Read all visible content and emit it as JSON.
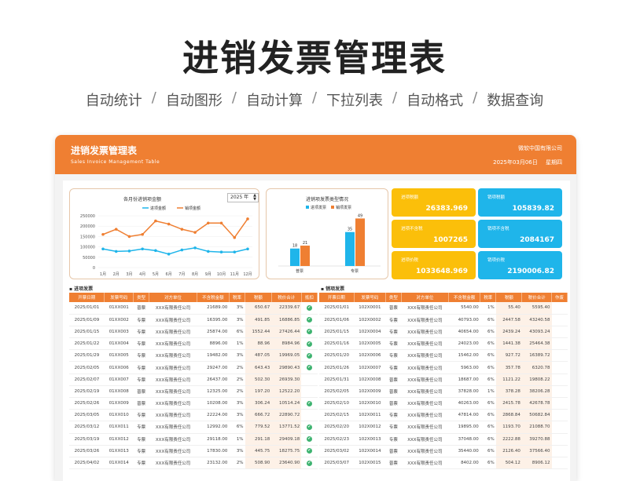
{
  "hero": {
    "title": "进销发票管理表",
    "features": [
      "自动统计",
      "自动图形",
      "自动计算",
      "下拉列表",
      "自动格式",
      "数据查询"
    ]
  },
  "header": {
    "title": "进销发票管理表",
    "subtitle": "Sales Invoice Management Table",
    "company": "微软中国有限公司",
    "date": "2025年03月06日",
    "weekday": "星期四"
  },
  "line_panel": {
    "title": "各月份进销项金额",
    "year": "2025 年"
  },
  "bar_panel": {
    "title": "进销项发票类型情况"
  },
  "kpis": [
    {
      "label": "进项税额",
      "value": "26383.969",
      "color": "#fbbf0a"
    },
    {
      "label": "销项税额",
      "value": "105839.82",
      "color": "#1fb5ea"
    },
    {
      "label": "进项不含税",
      "value": "1007265",
      "color": "#fbbf0a"
    },
    {
      "label": "销项不含税",
      "value": "2084167",
      "color": "#1fb5ea"
    },
    {
      "label": "进项价税",
      "value": "1033648.969",
      "color": "#fbbf0a"
    },
    {
      "label": "销项价税",
      "value": "2190006.82",
      "color": "#1fb5ea"
    }
  ],
  "chart_data": [
    {
      "type": "line",
      "title": "各月份进销项金额",
      "x": [
        "1月",
        "2月",
        "3月",
        "4月",
        "5月",
        "6月",
        "7月",
        "8月",
        "9月",
        "10月",
        "11月",
        "12月"
      ],
      "yticks": [
        "250000",
        "200000",
        "150000",
        "100000",
        "50000",
        "0"
      ],
      "ylim": [
        0,
        250000
      ],
      "series": [
        {
          "name": "进项金额",
          "color": "#1fb5ea",
          "values": [
            90000,
            78000,
            80000,
            90000,
            82000,
            65000,
            85000,
            95000,
            78000,
            75000,
            75000,
            90000
          ]
        },
        {
          "name": "销项金额",
          "color": "#ef7f32",
          "values": [
            160000,
            185000,
            150000,
            160000,
            225000,
            210000,
            185000,
            170000,
            215000,
            215000,
            145000,
            235000
          ]
        }
      ],
      "legend": "top"
    },
    {
      "type": "bar",
      "title": "进销项发票类型情况",
      "categories": [
        "普票",
        "专票"
      ],
      "series": [
        {
          "name": "进项发票",
          "color": "#1fb5ea",
          "values": [
            18,
            35
          ]
        },
        {
          "name": "销项发票",
          "color": "#ef7f32",
          "values": [
            21,
            49
          ]
        }
      ],
      "ylim": [
        0,
        55
      ],
      "legend": "top"
    }
  ],
  "purchase": {
    "label": "进项发票",
    "headers": [
      "开票日期",
      "发票号码",
      "类型",
      "对方单位",
      "不含税金额",
      "税率",
      "税额",
      "税价合计",
      "抵扣"
    ],
    "rows": [
      [
        "2025/01/01",
        "01XX001",
        "普票",
        "XXX有限责任公司",
        "21689.00",
        "3%",
        "650.67",
        "22339.67",
        "✔"
      ],
      [
        "2025/01/09",
        "01XX002",
        "专票",
        "XXX有限责任公司",
        "16395.00",
        "3%",
        "491.85",
        "16886.85",
        "✔"
      ],
      [
        "2025/01/15",
        "01XX003",
        "专票",
        "XXX有限责任公司",
        "25874.00",
        "6%",
        "1552.44",
        "27426.44",
        "✔"
      ],
      [
        "2025/01/22",
        "01XX004",
        "专票",
        "XXX有限责任公司",
        "8896.00",
        "1%",
        "88.96",
        "8984.96",
        "✔"
      ],
      [
        "2025/01/29",
        "01XX005",
        "专票",
        "XXX有限责任公司",
        "19482.00",
        "3%",
        "487.05",
        "19969.05",
        "✔"
      ],
      [
        "2025/02/05",
        "01XX006",
        "专票",
        "XXX有限责任公司",
        "29247.00",
        "2%",
        "643.43",
        "29890.43",
        "✔"
      ],
      [
        "2025/02/07",
        "01XX007",
        "专票",
        "XXX有限责任公司",
        "26437.00",
        "2%",
        "502.30",
        "26939.30",
        ""
      ],
      [
        "2025/02/19",
        "01XX008",
        "普票",
        "XXX有限责任公司",
        "12325.00",
        "2%",
        "197.20",
        "12522.20",
        ""
      ],
      [
        "2025/02/26",
        "01XX009",
        "普票",
        "XXX有限责任公司",
        "10208.00",
        "3%",
        "306.24",
        "10514.24",
        "✔"
      ],
      [
        "2025/03/05",
        "01XX010",
        "专票",
        "XXX有限责任公司",
        "22224.00",
        "3%",
        "666.72",
        "22890.72",
        ""
      ],
      [
        "2025/03/12",
        "01XX011",
        "专票",
        "XXX有限责任公司",
        "12992.00",
        "6%",
        "779.52",
        "13771.52",
        "✔"
      ],
      [
        "2025/03/19",
        "01XX012",
        "专票",
        "XXX有限责任公司",
        "29118.00",
        "1%",
        "291.18",
        "29409.18",
        "✔"
      ],
      [
        "2025/03/26",
        "01XX013",
        "专票",
        "XXX有限责任公司",
        "17830.00",
        "3%",
        "445.75",
        "18275.75",
        "✔"
      ],
      [
        "2025/04/02",
        "01XX014",
        "专票",
        "XXX有限责任公司",
        "23132.00",
        "2%",
        "508.90",
        "23640.90",
        "✔"
      ]
    ]
  },
  "sales": {
    "label": "销项发票",
    "headers": [
      "开票日期",
      "发票号码",
      "类型",
      "对方单位",
      "不含税金额",
      "税率",
      "税额",
      "税价合计",
      "作废"
    ],
    "rows": [
      [
        "2025/01/01",
        "102X0001",
        "普票",
        "XXX有限责任公司",
        "5540.00",
        "1%",
        "55.40",
        "5595.40",
        ""
      ],
      [
        "2025/01/06",
        "102X0002",
        "专票",
        "XXX有限责任公司",
        "40793.00",
        "6%",
        "2447.58",
        "43240.58",
        ""
      ],
      [
        "2025/01/15",
        "102X0004",
        "专票",
        "XXX有限责任公司",
        "40654.00",
        "6%",
        "2439.24",
        "43093.24",
        ""
      ],
      [
        "2025/01/16",
        "102X0005",
        "专票",
        "XXX有限责任公司",
        "24023.00",
        "6%",
        "1441.38",
        "25464.38",
        ""
      ],
      [
        "2025/01/20",
        "102X0006",
        "专票",
        "XXX有限责任公司",
        "15462.00",
        "6%",
        "927.72",
        "16389.72",
        ""
      ],
      [
        "2025/01/26",
        "102X0007",
        "专票",
        "XXX有限责任公司",
        "5963.00",
        "6%",
        "357.78",
        "6320.78",
        ""
      ],
      [
        "2025/01/31",
        "102X0008",
        "普票",
        "XXX有限责任公司",
        "18687.00",
        "6%",
        "1121.22",
        "19808.22",
        ""
      ],
      [
        "2025/02/05",
        "102X0009",
        "普票",
        "XXX有限责任公司",
        "37828.00",
        "1%",
        "378.28",
        "38206.28",
        ""
      ],
      [
        "2025/02/10",
        "102X0010",
        "普票",
        "XXX有限责任公司",
        "40263.00",
        "6%",
        "2415.78",
        "42678.78",
        ""
      ],
      [
        "2025/02/15",
        "102X0011",
        "专票",
        "XXX有限责任公司",
        "47814.00",
        "6%",
        "2868.84",
        "50682.84",
        ""
      ],
      [
        "2025/02/20",
        "102X0012",
        "专票",
        "XXX有限责任公司",
        "19895.00",
        "6%",
        "1193.70",
        "21088.70",
        ""
      ],
      [
        "2025/02/23",
        "102X0013",
        "专票",
        "XXX有限责任公司",
        "37048.00",
        "6%",
        "2222.88",
        "39270.88",
        ""
      ],
      [
        "2025/03/02",
        "102X0014",
        "普票",
        "XXX有限责任公司",
        "35440.00",
        "6%",
        "2126.40",
        "37566.40",
        ""
      ],
      [
        "2025/03/07",
        "102X0015",
        "普票",
        "XXX有限责任公司",
        "8402.00",
        "6%",
        "504.12",
        "8906.12",
        ""
      ]
    ]
  }
}
